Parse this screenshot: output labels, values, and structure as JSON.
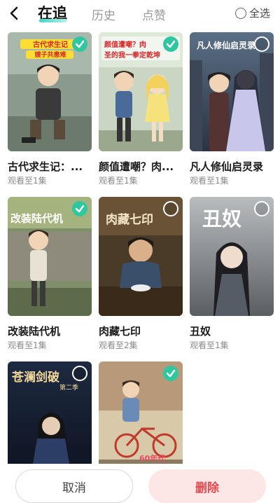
{
  "header": {
    "back_icon": "chevron-left-icon",
    "tabs": [
      {
        "label": "在追",
        "active": true
      },
      {
        "label": "历史",
        "active": false
      },
      {
        "label": "点赞",
        "active": false
      }
    ],
    "select_all_label": "全选"
  },
  "items": [
    {
      "title": "古代求生记：...",
      "progress": "观看至1集",
      "selected": true,
      "cover_text": "古代求生记",
      "cover_subtext": "嫂子共患难"
    },
    {
      "title": "颜值遭嘲？肉...",
      "progress": "观看至1集",
      "selected": true,
      "cover_text": "颜值遭嘲？肉",
      "cover_subtext": "圣的我一拳定乾坤"
    },
    {
      "title": "凡人修仙启灵录",
      "progress": "观看至1集",
      "selected": false,
      "cover_text": "凡人修仙启灵录",
      "cover_subtext": ""
    },
    {
      "title": "改装陆代机",
      "progress": "观看至1集",
      "selected": true,
      "cover_text": "改装陆代机",
      "cover_subtext": ""
    },
    {
      "title": "肉藏七印",
      "progress": "观看至2集",
      "selected": false,
      "cover_text": "肉藏七印",
      "cover_subtext": ""
    },
    {
      "title": "丑奴",
      "progress": "观看至1集",
      "selected": false,
      "cover_text": "丑奴",
      "cover_subtext": ""
    },
    {
      "title": "",
      "progress": "",
      "selected": false,
      "cover_text": "苍澜剑破",
      "cover_subtext": "第二季"
    },
    {
      "title": "",
      "progress": "",
      "selected": true,
      "cover_text": "60年代",
      "cover_subtext": ""
    }
  ],
  "footer": {
    "cancel_label": "取消",
    "delete_label": "删除"
  },
  "colors": {
    "accent": "#2fc7a0",
    "delete_bg": "#fde6e6",
    "delete_text": "#e5484d"
  }
}
